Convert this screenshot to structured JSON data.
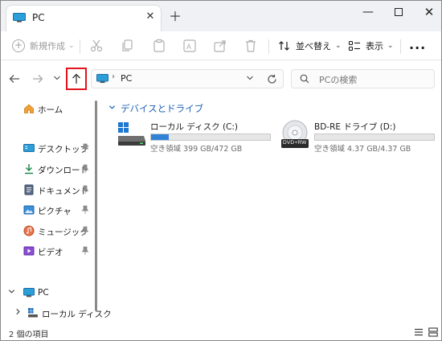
{
  "window": {
    "tab_title": "PC",
    "tab_close": "✕",
    "new_tab": "＋",
    "minimize": "—",
    "close": "✕"
  },
  "toolbar": {
    "new_label": "新規作成",
    "sort_label": "並べ替え",
    "view_label": "表示",
    "more_label": "..."
  },
  "address": {
    "path": "PC",
    "search_placeholder": "PCの検索"
  },
  "sidebar": {
    "home": "ホーム",
    "items": [
      {
        "label": "デスクトップ",
        "icon": "desktop-folder-icon",
        "pinned": true
      },
      {
        "label": "ダウンロード",
        "icon": "download-folder-icon",
        "pinned": true
      },
      {
        "label": "ドキュメント",
        "icon": "documents-folder-icon",
        "pinned": true
      },
      {
        "label": "ピクチャ",
        "icon": "pictures-folder-icon",
        "pinned": true
      },
      {
        "label": "ミュージック",
        "icon": "music-folder-icon",
        "pinned": true
      },
      {
        "label": "ビデオ",
        "icon": "videos-folder-icon",
        "pinned": true
      }
    ],
    "pc": "PC",
    "local_disk": "ローカル ディスク"
  },
  "content": {
    "group_header": "デバイスとドライブ",
    "drives": [
      {
        "name": "ローカル ディスク (C:)",
        "free_text": "空き領域 399 GB/472 GB",
        "used_fraction": 0.15,
        "icon": "windows-drive-icon"
      },
      {
        "name": "BD-RE ドライブ (D:)",
        "free_text": "空き領域 4.37 GB/4.37 GB",
        "used_fraction": 0.0,
        "icon": "optical-disc-icon",
        "badge": "DVD+RW"
      }
    ]
  },
  "status": {
    "item_count": "2 個の項目"
  },
  "colors": {
    "accent": "#2f82d6",
    "highlight_border": "#e0141b",
    "group_header": "#1a5fb4"
  }
}
